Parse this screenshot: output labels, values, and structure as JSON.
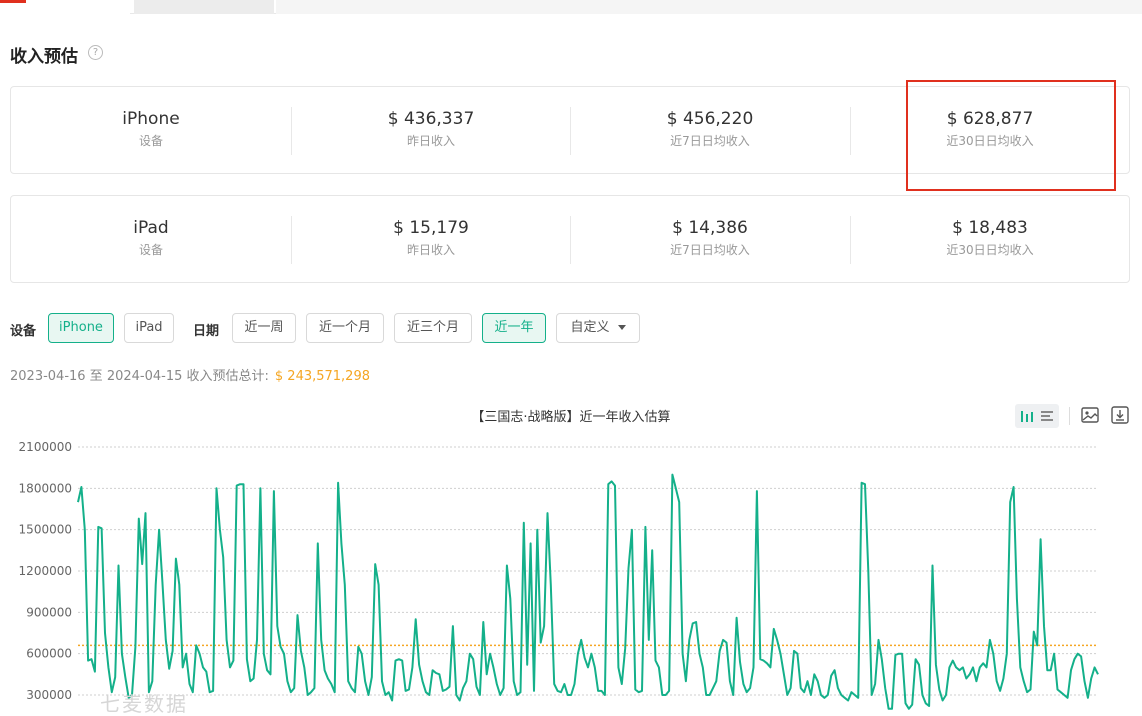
{
  "section": {
    "title": "收入预估",
    "help_icon": "question-circle-icon"
  },
  "cards": [
    {
      "device": "iPhone",
      "device_label": "设备",
      "metrics": [
        {
          "value": "$ 436,337",
          "label": "昨日收入"
        },
        {
          "value": "$ 456,220",
          "label": "近7日日均收入"
        },
        {
          "value": "$ 628,877",
          "label": "近30日日均收入"
        }
      ]
    },
    {
      "device": "iPad",
      "device_label": "设备",
      "metrics": [
        {
          "value": "$ 15,179",
          "label": "昨日收入"
        },
        {
          "value": "$ 14,386",
          "label": "近7日日均收入"
        },
        {
          "value": "$ 18,483",
          "label": "近30日日均收入"
        }
      ]
    }
  ],
  "filters": {
    "device_label": "设备",
    "device_options": [
      "iPhone",
      "iPad"
    ],
    "device_selected": "iPhone",
    "date_label": "日期",
    "date_options": [
      "近一周",
      "近一个月",
      "近三个月",
      "近一年"
    ],
    "date_selected": "近一年",
    "custom_label": "自定义"
  },
  "summary": {
    "range_text": "2023-04-16 至 2024-04-15 收入预估总计:",
    "total": "$ 243,571,298"
  },
  "colors": {
    "accent": "#14b08a",
    "highlight": "#e0301e",
    "average_line": "#f5a623"
  },
  "toolbar_icons": [
    "bar-chart-icon",
    "list-icon",
    "image-icon",
    "download-icon"
  ],
  "watermark": "七麦数据",
  "chart_data": {
    "type": "line",
    "title": "【三国志·战略版】近一年收入估算",
    "x_range": [
      "2023-04-16",
      "2024-04-15"
    ],
    "yticks": [
      300000,
      600000,
      900000,
      1200000,
      1500000,
      1800000,
      2100000
    ],
    "ylim": [
      300000,
      2100000
    ],
    "grid": true,
    "average": 660000,
    "series": [
      {
        "values": [
          1700000,
          1810000,
          1500000,
          550000,
          560000,
          470000,
          1520000,
          1510000,
          750000,
          500000,
          320000,
          430000,
          1240000,
          600000,
          430000,
          280000,
          300000,
          650000,
          1580000,
          1250000,
          1620000,
          320000,
          400000,
          1100000,
          1500000,
          1120000,
          700000,
          490000,
          620000,
          1290000,
          1100000,
          500000,
          600000,
          380000,
          320000,
          660000,
          600000,
          500000,
          470000,
          320000,
          330000,
          1800000,
          1500000,
          1300000,
          700000,
          500000,
          550000,
          1820000,
          1830000,
          1830000,
          560000,
          400000,
          420000,
          700000,
          1800000,
          600000,
          480000,
          450000,
          1780000,
          800000,
          650000,
          600000,
          400000,
          320000,
          350000,
          880000,
          620000,
          500000,
          300000,
          320000,
          350000,
          1400000,
          700000,
          480000,
          420000,
          380000,
          320000,
          1840000,
          1400000,
          1100000,
          400000,
          350000,
          320000,
          650000,
          600000,
          400000,
          300000,
          430000,
          1250000,
          1100000,
          400000,
          300000,
          320000,
          260000,
          550000,
          560000,
          550000,
          330000,
          340000,
          500000,
          850000,
          520000,
          400000,
          320000,
          300000,
          480000,
          460000,
          450000,
          330000,
          340000,
          360000,
          800000,
          300000,
          260000,
          350000,
          400000,
          600000,
          560000,
          360000,
          300000,
          830000,
          450000,
          600000,
          500000,
          380000,
          300000,
          350000,
          1240000,
          1000000,
          400000,
          300000,
          320000,
          1550000,
          520000,
          1400000,
          330000,
          1500000,
          680000,
          800000,
          1620000,
          1100000,
          380000,
          330000,
          320000,
          380000,
          300000,
          300000,
          380000,
          600000,
          700000,
          570000,
          500000,
          600000,
          500000,
          330000,
          330000,
          300000,
          1830000,
          1850000,
          1820000,
          500000,
          380000,
          640000,
          1220000,
          1500000,
          340000,
          320000,
          330000,
          1520000,
          700000,
          1350000,
          550000,
          500000,
          300000,
          300000,
          330000,
          1900000,
          1800000,
          1700000,
          600000,
          400000,
          700000,
          820000,
          830000,
          600000,
          500000,
          300000,
          300000,
          350000,
          400000,
          620000,
          700000,
          680000,
          400000,
          300000,
          860000,
          540000,
          380000,
          320000,
          350000,
          500000,
          1780000,
          560000,
          550000,
          530000,
          500000,
          780000,
          700000,
          600000,
          450000,
          300000,
          350000,
          620000,
          600000,
          350000,
          320000,
          400000,
          300000,
          450000,
          400000,
          300000,
          280000,
          300000,
          440000,
          480000,
          350000,
          300000,
          280000,
          260000,
          320000,
          300000,
          280000,
          1840000,
          1830000,
          1200000,
          300000,
          380000,
          700000,
          560000,
          350000,
          200000,
          200000,
          590000,
          600000,
          600000,
          240000,
          200000,
          230000,
          560000,
          520000,
          300000,
          240000,
          220000,
          1240000,
          520000,
          340000,
          260000,
          300000,
          500000,
          550000,
          500000,
          480000,
          500000,
          420000,
          450000,
          500000,
          400000,
          500000,
          530000,
          500000,
          700000,
          600000,
          400000,
          330000,
          420000,
          600000,
          1700000,
          1810000,
          1000000,
          500000,
          400000,
          320000,
          340000,
          760000,
          660000,
          1430000,
          800000,
          480000,
          480000,
          600000,
          340000,
          320000,
          300000,
          280000,
          480000,
          560000,
          600000,
          580000,
          400000,
          280000,
          420000,
          500000,
          450000
        ]
      }
    ]
  }
}
